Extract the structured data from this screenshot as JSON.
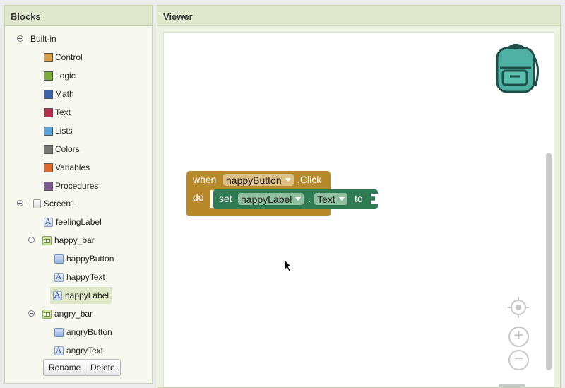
{
  "blocks_panel": {
    "title": "Blocks",
    "builtin": {
      "label": "Built-in",
      "items": [
        {
          "label": "Control",
          "color": "#d9a04a"
        },
        {
          "label": "Logic",
          "color": "#7aab3b"
        },
        {
          "label": "Math",
          "color": "#3d63a8"
        },
        {
          "label": "Text",
          "color": "#b5304f"
        },
        {
          "label": "Lists",
          "color": "#57a6d9"
        },
        {
          "label": "Colors",
          "color": "#777777"
        },
        {
          "label": "Variables",
          "color": "#e06a2c"
        },
        {
          "label": "Procedures",
          "color": "#7b5a94"
        }
      ]
    },
    "screen": {
      "label": "Screen1",
      "children": {
        "feeling_label": "feelingLabel",
        "happy_bar": "happy_bar",
        "happy_button": "happyButton",
        "happy_text": "happyText",
        "happy_label": "happyLabel",
        "angry_bar": "angry_bar",
        "angry_button": "angryButton",
        "angry_text": "angryText"
      }
    },
    "rename_label": "Rename",
    "delete_label": "Delete"
  },
  "viewer": {
    "title": "Viewer",
    "event_block": {
      "when": "when",
      "component": "happyButton",
      "event": ".Click",
      "do": "do",
      "color": "#b8892b"
    },
    "set_block": {
      "set": "set",
      "component": "happyLabel",
      "dot": ".",
      "property": "Text",
      "to": "to",
      "color": "#2f7b53"
    },
    "controls": {
      "backpack_icon": "backpack-icon",
      "recenter_icon": "target-icon",
      "zoom_in_label": "+",
      "zoom_out_label": "−"
    }
  }
}
